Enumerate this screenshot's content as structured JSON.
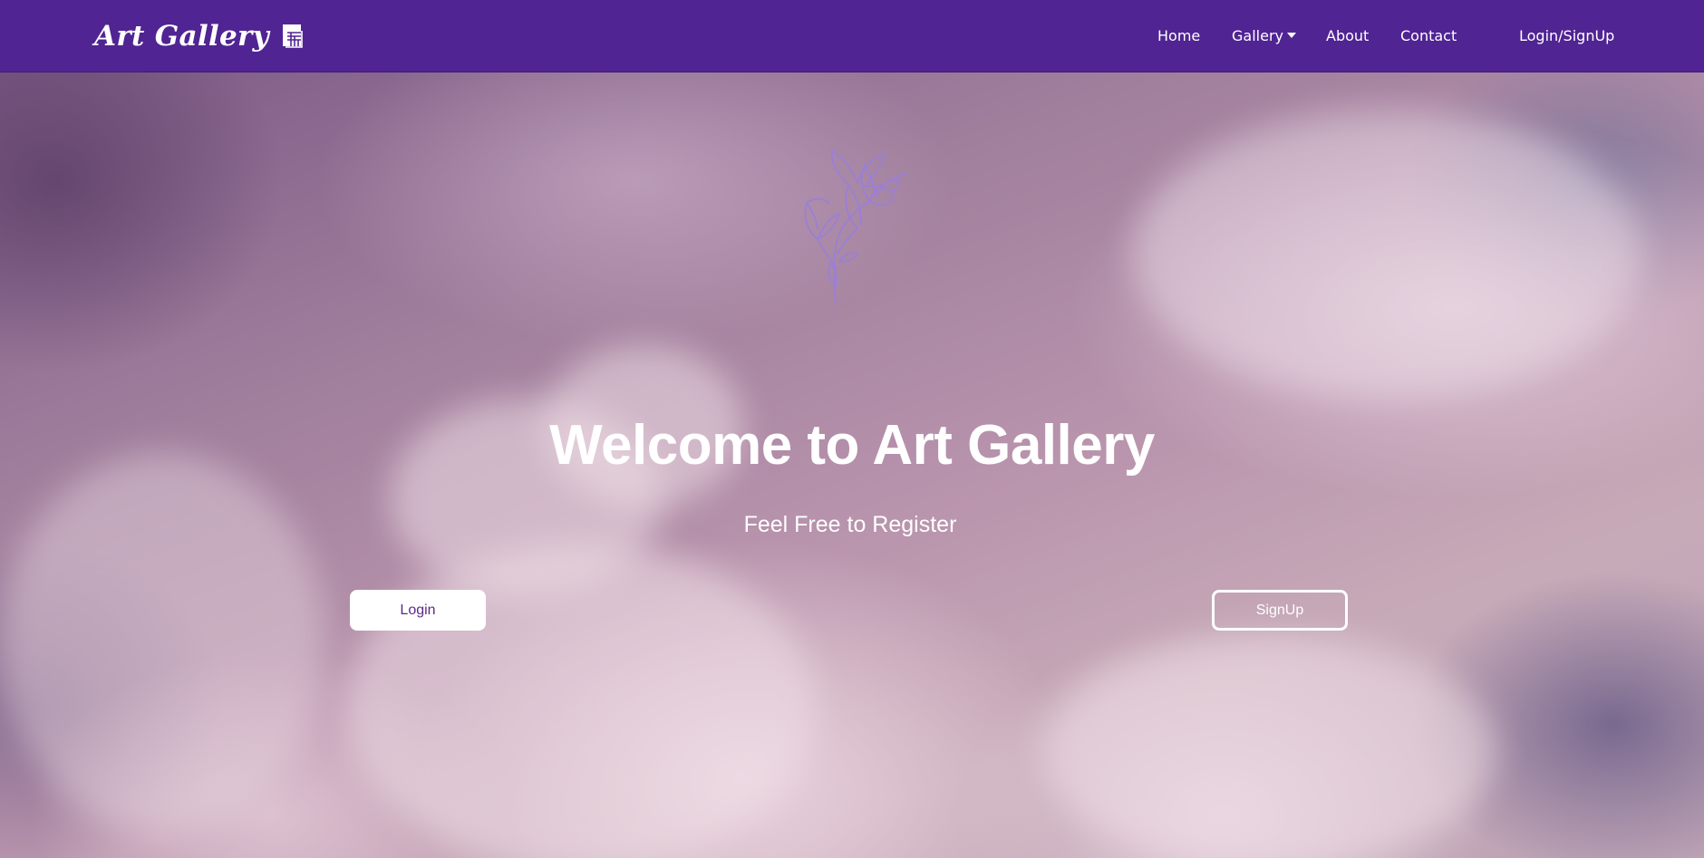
{
  "nav": {
    "brand": "Art Gallery",
    "brand_icon": "gallery-logo-icon",
    "links": {
      "home": "Home",
      "gallery": "Gallery",
      "about": "About",
      "contact": "Contact",
      "auth": "Login/SignUp"
    },
    "gallery_dropdown_icon": "caret-down-icon"
  },
  "hero": {
    "title": "Welcome to Art Gallery",
    "subtitle": "Feel Free to Register",
    "login_label": "Login",
    "signup_label": "SignUp",
    "decoration_icon": "flower-outline-icon"
  },
  "colors": {
    "navbar": "#502493",
    "flower_stroke": "#9b7fd6",
    "login_text": "#5a2a8a",
    "white": "#ffffff"
  }
}
